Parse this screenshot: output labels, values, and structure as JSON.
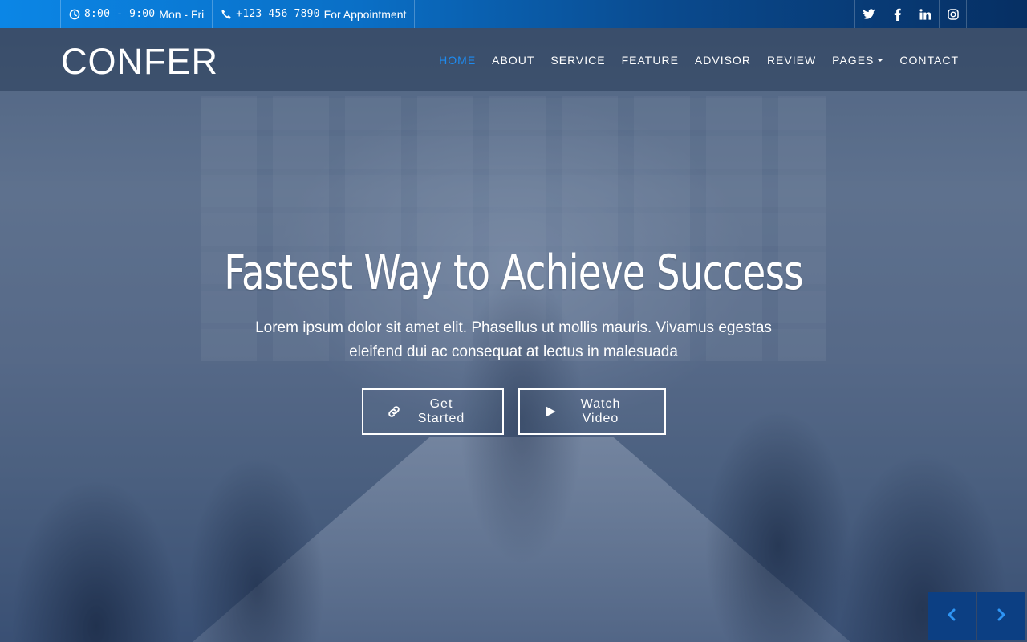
{
  "topbar": {
    "hours_time": "8:00 - 9:00",
    "hours_days": "Mon - Fri",
    "phone": "+123 456 7890",
    "phone_note": "For Appointment",
    "socials": [
      "twitter-icon",
      "facebook-icon",
      "linkedin-icon",
      "instagram-icon"
    ]
  },
  "navbar": {
    "brand": "CONFER",
    "items": [
      {
        "label": "HOME",
        "active": true
      },
      {
        "label": "ABOUT"
      },
      {
        "label": "SERVICE"
      },
      {
        "label": "FEATURE"
      },
      {
        "label": "ADVISOR"
      },
      {
        "label": "REVIEW"
      },
      {
        "label": "PAGES",
        "dropdown": true
      },
      {
        "label": "CONTACT"
      }
    ]
  },
  "hero": {
    "title": "Fastest Way to Achieve Success",
    "text": "Lorem ipsum dolor sit amet elit. Phasellus ut mollis mauris. Vivamus egestas eleifend dui ac consequat at lectus in malesuada",
    "buttons": {
      "get_started": "Get Started",
      "watch_video": "Watch Video"
    }
  },
  "carousel": {
    "prev_icon": "chevron-left-icon",
    "next_icon": "chevron-right-icon"
  },
  "colors": {
    "accent": "#1e8bf0",
    "topbar_start": "#0b86e6",
    "topbar_end": "#062f63",
    "control_bg": "#0c3f83"
  }
}
